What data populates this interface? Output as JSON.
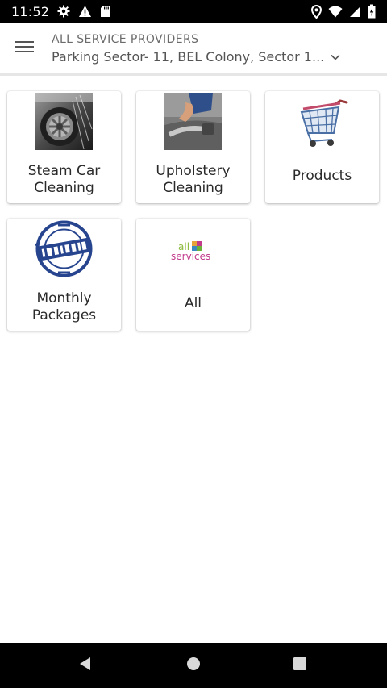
{
  "status_bar": {
    "time": "11:52",
    "left_icons": [
      "gear-icon",
      "warning-icon",
      "sd-card-icon"
    ],
    "right_icons": [
      "location-pin-icon",
      "wifi-icon",
      "signal-icon",
      "battery-icon"
    ]
  },
  "header": {
    "title": "ALL SERVICE PROVIDERS",
    "location": "Parking Sector- 11, BEL Colony, Sector 1...",
    "menu_icon": "hamburger-menu-icon",
    "dropdown_icon": "chevron-down-icon"
  },
  "tiles": [
    {
      "label_line1": "Steam Car",
      "label_line2": "Cleaning",
      "image": "car-wheel-image"
    },
    {
      "label_line1": "Upholstery",
      "label_line2": "Cleaning",
      "image": "upholstery-vacuum-image"
    },
    {
      "label_line1": "Products",
      "image": "shopping-cart-image"
    },
    {
      "label_line1": "Monthly",
      "label_line2": "Packages",
      "image": "monthly-stamp-image"
    },
    {
      "label_line1": "All",
      "image": "all-services-logo",
      "logo_line1": "all",
      "logo_line2": "services"
    }
  ],
  "nav_bar": {
    "icons": [
      "back-icon",
      "home-icon",
      "recents-icon"
    ]
  },
  "colors": {
    "status_bar": "#000000",
    "header_text": "#6b6b6b",
    "tile_text": "#2a2a2a"
  }
}
